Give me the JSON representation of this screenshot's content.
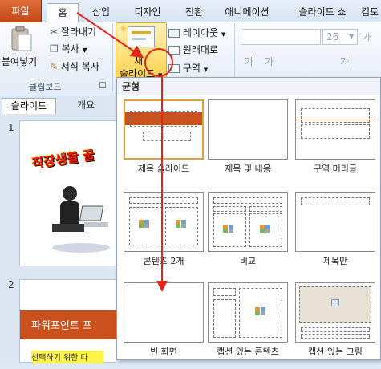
{
  "tabs": {
    "file": "파일",
    "home": "홈",
    "insert": "삽입",
    "design": "디자인",
    "transitions": "전환",
    "animations": "애니메이션",
    "slideshow": "슬라이드 쇼",
    "review": "검토"
  },
  "clipboard": {
    "paste": "붙여넣기",
    "cut": "잘라내기",
    "copy": "복사",
    "format_painter": "서식 복사",
    "group_label": "클립보드"
  },
  "slides_group": {
    "new_slide_top": "새",
    "new_slide_bottom": "슬라이드",
    "layout": "레이아웃",
    "reset": "원래대로",
    "section": "구역"
  },
  "font_group": {
    "size_value": "26",
    "grow": "가",
    "shrink": "가",
    "clear": "가",
    "change_case": "가"
  },
  "panel": {
    "slides_tab": "슬라이드",
    "outline_tab": "개요",
    "slide1_num": "1",
    "slide2_num": "2",
    "slide1_title": "직장생활 꿀",
    "slide2_title": "파워포인트 프",
    "slide2_sub": "선택하기 위한 다"
  },
  "gallery": {
    "header": "균형",
    "layouts": [
      {
        "label": "제목 슬라이드"
      },
      {
        "label": "제목 및 내용"
      },
      {
        "label": "구역 머리글"
      },
      {
        "label": "콘텐츠 2개"
      },
      {
        "label": "비교"
      },
      {
        "label": "제목만"
      },
      {
        "label": "빈 화면"
      },
      {
        "label": "캡션 있는 콘텐츠"
      },
      {
        "label": "캡션 있는 그림"
      }
    ]
  },
  "colors": {
    "annotation_red": "#e3261b",
    "file_tab": "#c9511e",
    "highlight": "#ffd34f",
    "title_fill": "#c9511e"
  }
}
